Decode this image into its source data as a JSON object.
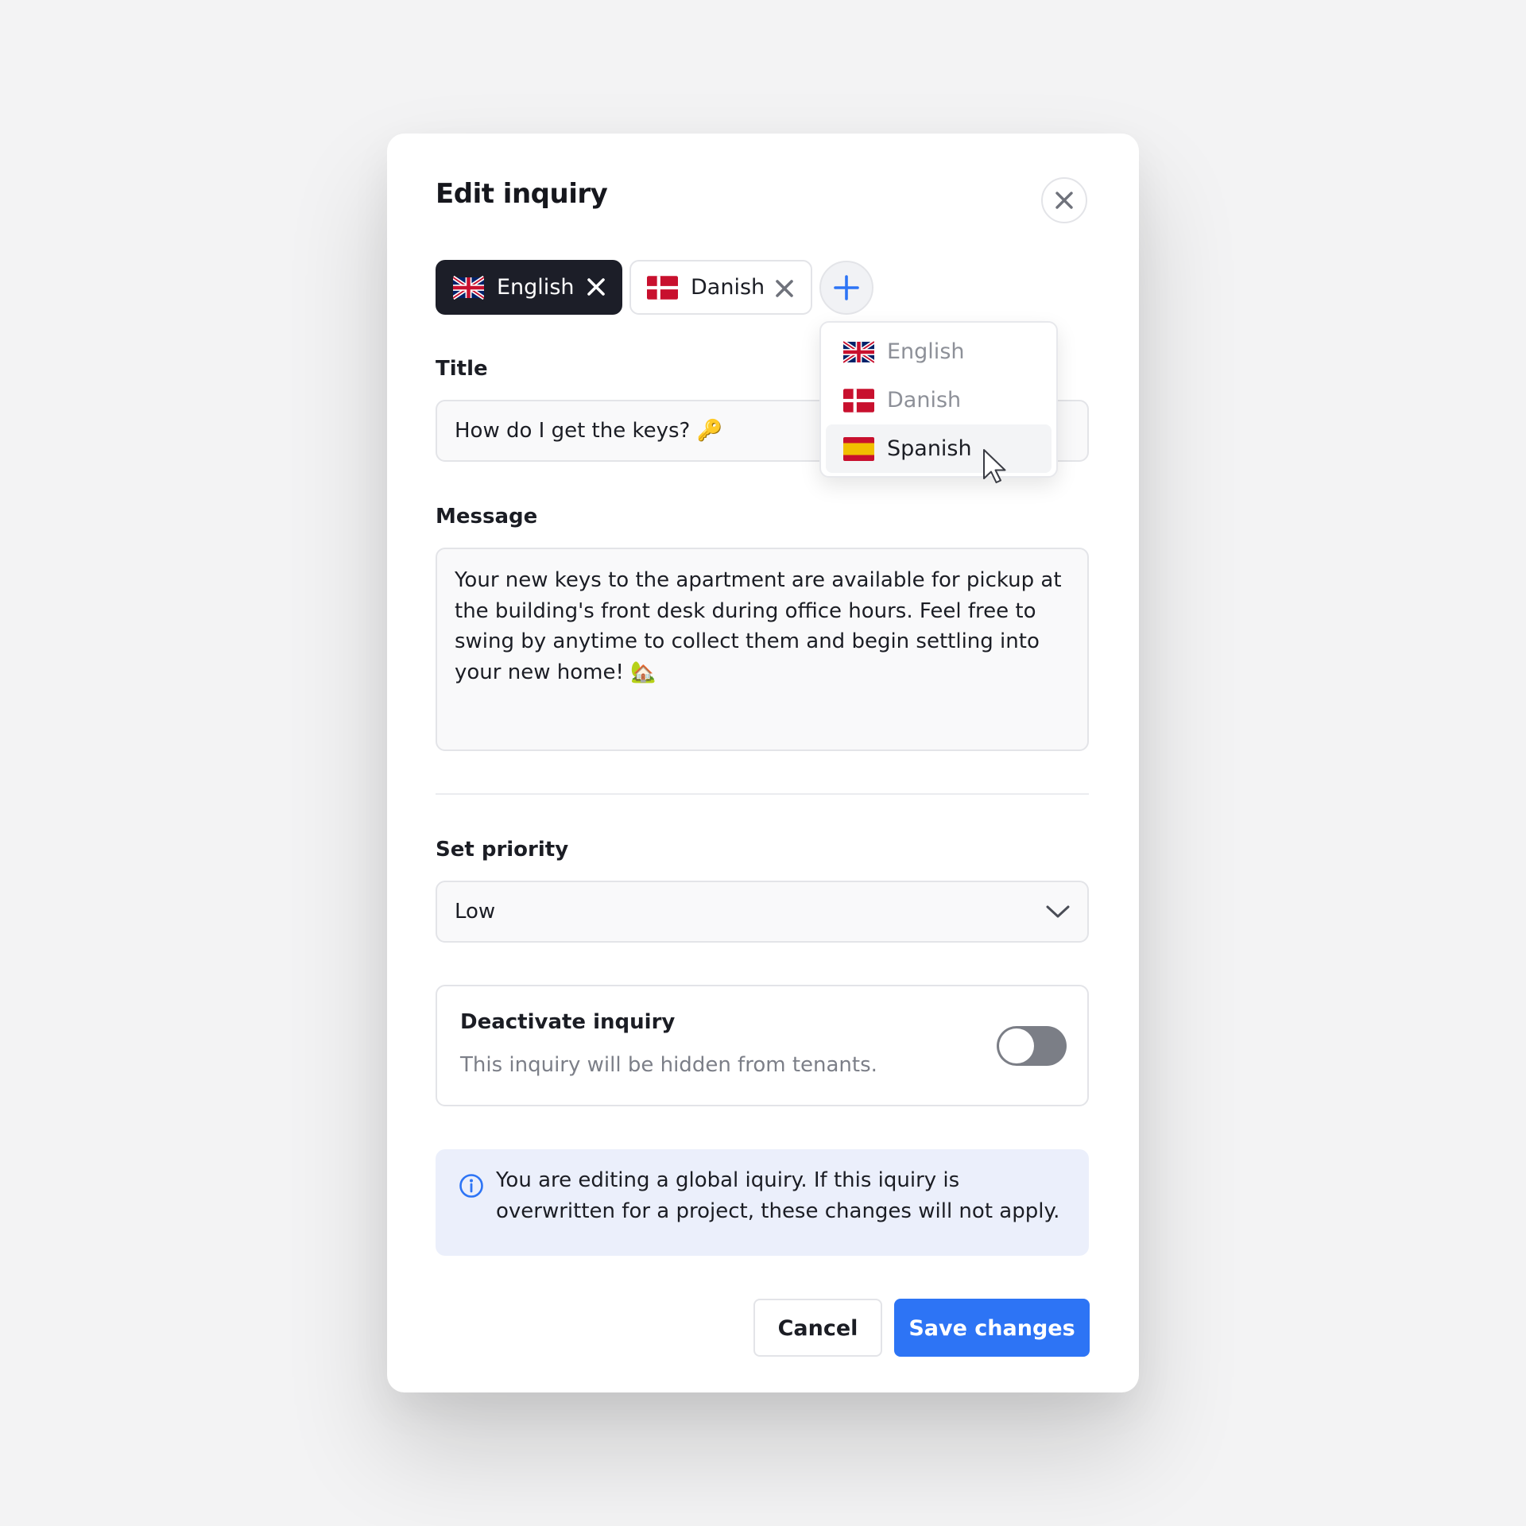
{
  "dialog": {
    "title": "Edit inquiry",
    "close_icon": "close-icon"
  },
  "languages": {
    "tabs": [
      {
        "label": "English",
        "flag": "uk-flag-icon",
        "active": true
      },
      {
        "label": "Danish",
        "flag": "denmark-flag-icon",
        "active": false
      }
    ],
    "add_icon": "plus-icon",
    "dropdown": {
      "options": [
        {
          "label": "English",
          "flag": "uk-flag-icon",
          "state": "disabled"
        },
        {
          "label": "Danish",
          "flag": "denmark-flag-icon",
          "state": "disabled"
        },
        {
          "label": "Spanish",
          "flag": "spain-flag-icon",
          "state": "hovered"
        }
      ]
    }
  },
  "form": {
    "title_label": "Title",
    "title_value": "How do I get the keys? 🔑",
    "message_label": "Message",
    "message_value": "Your new keys to the apartment are available for pickup at the building's front desk during office hours. Feel free to swing by anytime to collect them and begin settling into your new home! 🏡",
    "priority_label": "Set priority",
    "priority_value": "Low"
  },
  "deactivate": {
    "title": "Deactivate inquiry",
    "description": "This inquiry will be hidden from tenants.",
    "enabled": false
  },
  "notice": {
    "icon": "info-icon",
    "text": "You are editing a global iquiry. If this iquiry is overwritten for a project, these changes will not apply."
  },
  "actions": {
    "cancel_label": "Cancel",
    "save_label": "Save changes"
  },
  "colors": {
    "accent": "#2d74f5",
    "dark_chip": "#1c1e28",
    "toggle_off": "#7b7e86",
    "notice_bg": "#ebeffb"
  }
}
